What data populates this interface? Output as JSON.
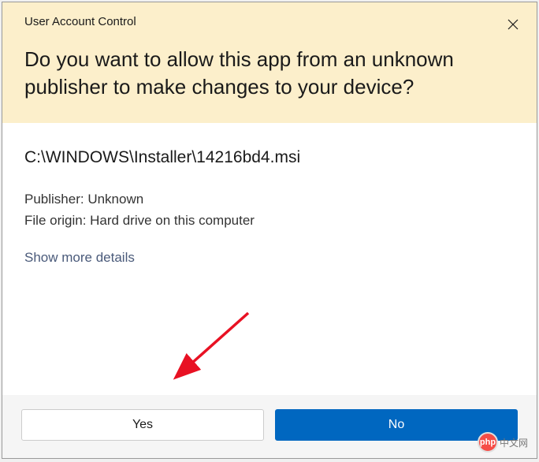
{
  "dialog": {
    "title": "User Account Control",
    "question": "Do you want to allow this app from an unknown publisher to make changes to your device?",
    "filePath": "C:\\WINDOWS\\Installer\\14216bd4.msi",
    "publisherLabel": "Publisher: Unknown",
    "fileOriginLabel": "File origin: Hard drive on this computer",
    "showDetails": "Show more details",
    "yesButton": "Yes",
    "noButton": "No"
  },
  "watermark": {
    "logo": "php",
    "text": "中文网"
  }
}
